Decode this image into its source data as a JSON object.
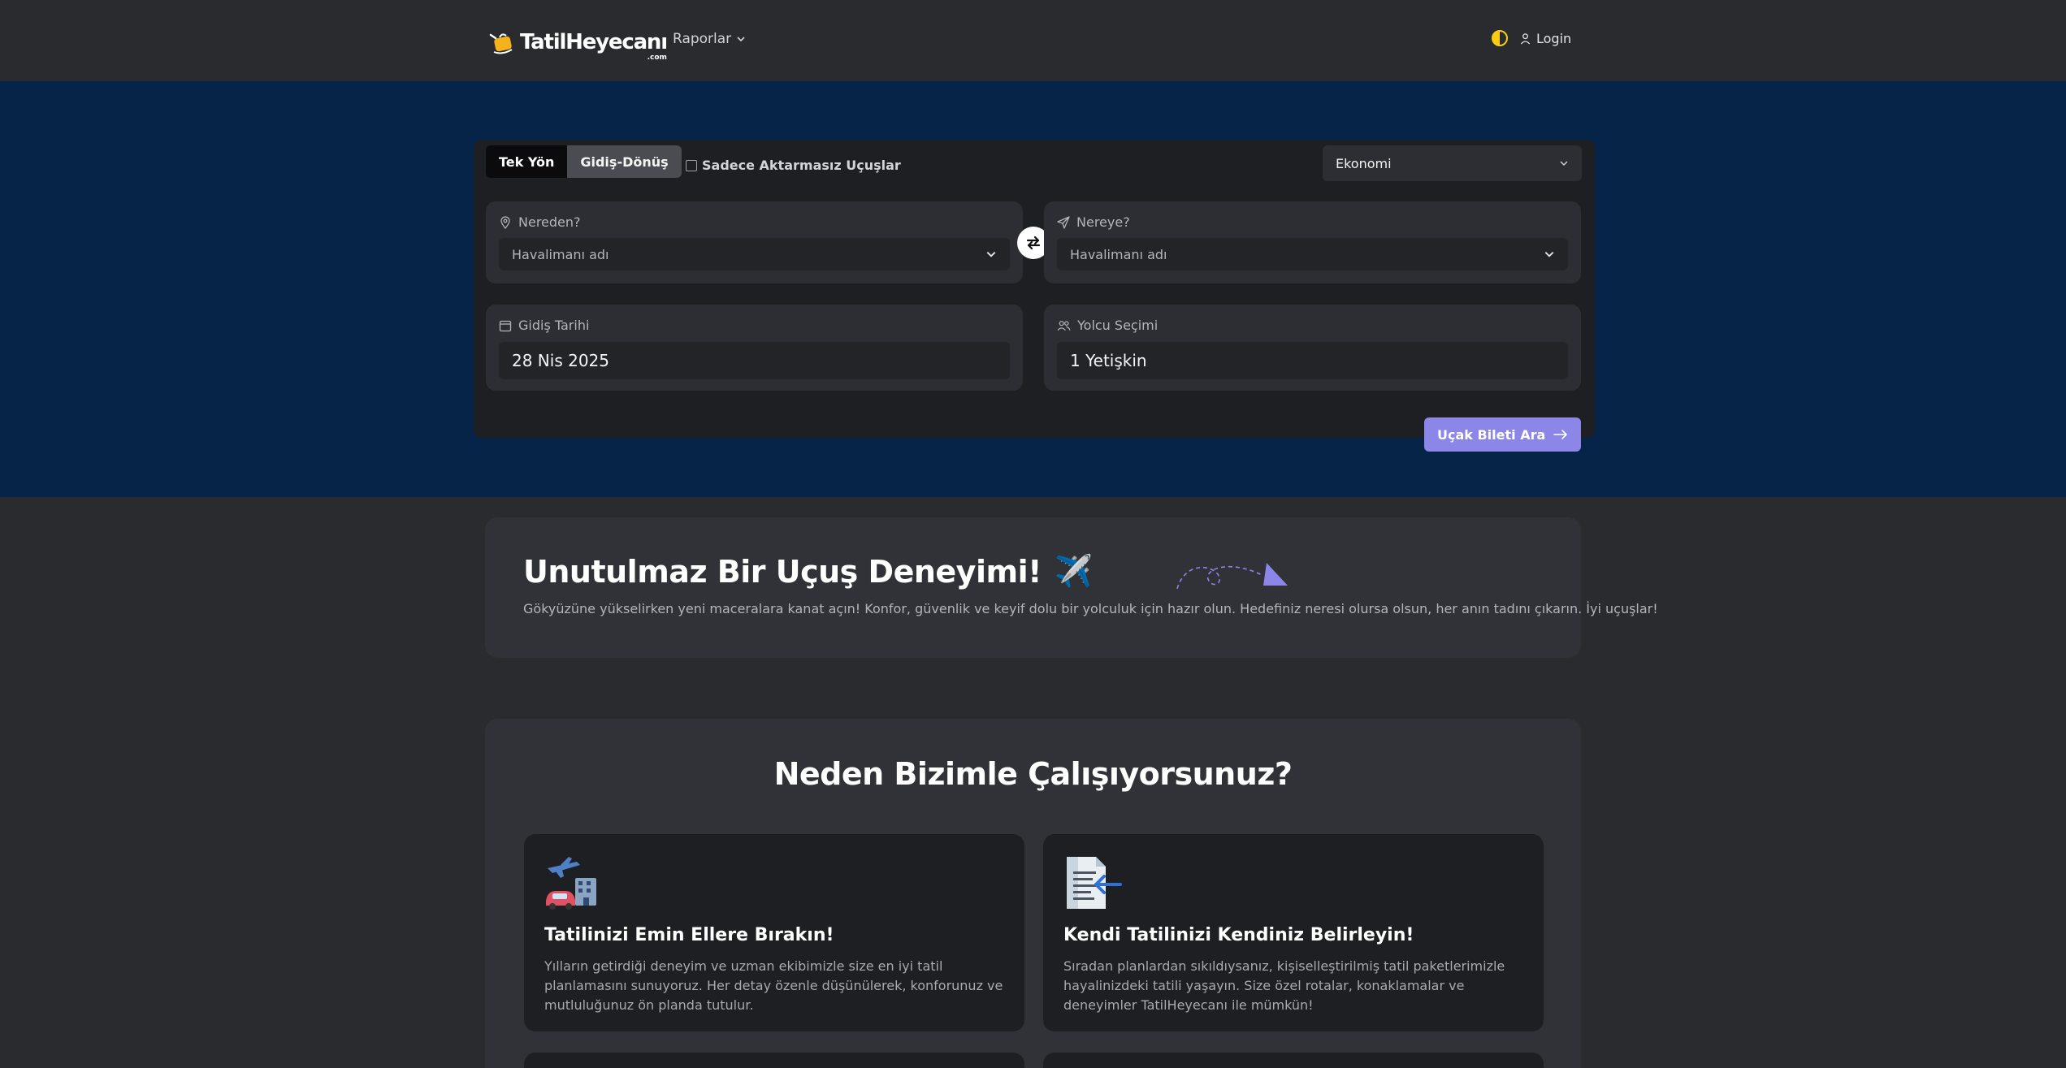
{
  "nav": {
    "logo_text": "TatilHeyecanı",
    "logo_suffix": ".com",
    "reports_label": "Raporlar",
    "login_label": "Login"
  },
  "search": {
    "trip_types": [
      "Tek Yön",
      "Gidiş-Dönüş"
    ],
    "active_trip_type": "Tek Yön",
    "nonstop_label": "Sadece Aktarmasız Uçuşlar",
    "nonstop_checked": false,
    "cabin_class": "Ekonomi",
    "from_label": "Nereden?",
    "from_placeholder": "Havalimanı adı",
    "to_label": "Nereye?",
    "to_placeholder": "Havalimanı adı",
    "date_label": "Gidiş Tarihi",
    "date_value": "28 Nis 2025",
    "passenger_label": "Yolcu Seçimi",
    "passenger_value": "1 Yetişkin",
    "search_button": "Uçak Bileti Ara"
  },
  "banner": {
    "title": "Unutulmaz Bir Uçuş Deneyimi!",
    "emoji": "✈️",
    "text": "Gökyüzüne yükselirken yeni maceralara kanat açın! Konfor, güvenlik ve keyif dolu bir yolculuk için hazır olun. Hedefiniz neresi olursa olsun, her anın tadını çıkarın. İyi uçuşlar!"
  },
  "why": {
    "title": "Neden Bizimle Çalışıyorsunuz?",
    "features": [
      {
        "icon": "travel-icon",
        "title": "Tatilinizi Emin Ellere Bırakın!",
        "text": "Yılların getirdiği deneyim ve uzman ekibimizle size en iyi tatil planlamasını sunuyoruz. Her detay özenle düşünülerek, konforunuz ve mutluluğunuz ön planda tutulur."
      },
      {
        "icon": "document-icon",
        "title": "Kendi Tatilinizi Kendiniz Belirleyin!",
        "text": "Sıradan planlardan sıkıldıysanız, kişiselleştirilmiş tatil paketlerimizle hayalinizdeki tatili yaşayın. Size özel rotalar, konaklamalar ve deneyimler TatilHeyecanı ile mümkün!"
      }
    ]
  },
  "colors": {
    "hero_bg": "#062447",
    "page_bg": "#2a2b2f",
    "accent": "#8b86e8",
    "logo_yellow": "#f5b21b"
  }
}
